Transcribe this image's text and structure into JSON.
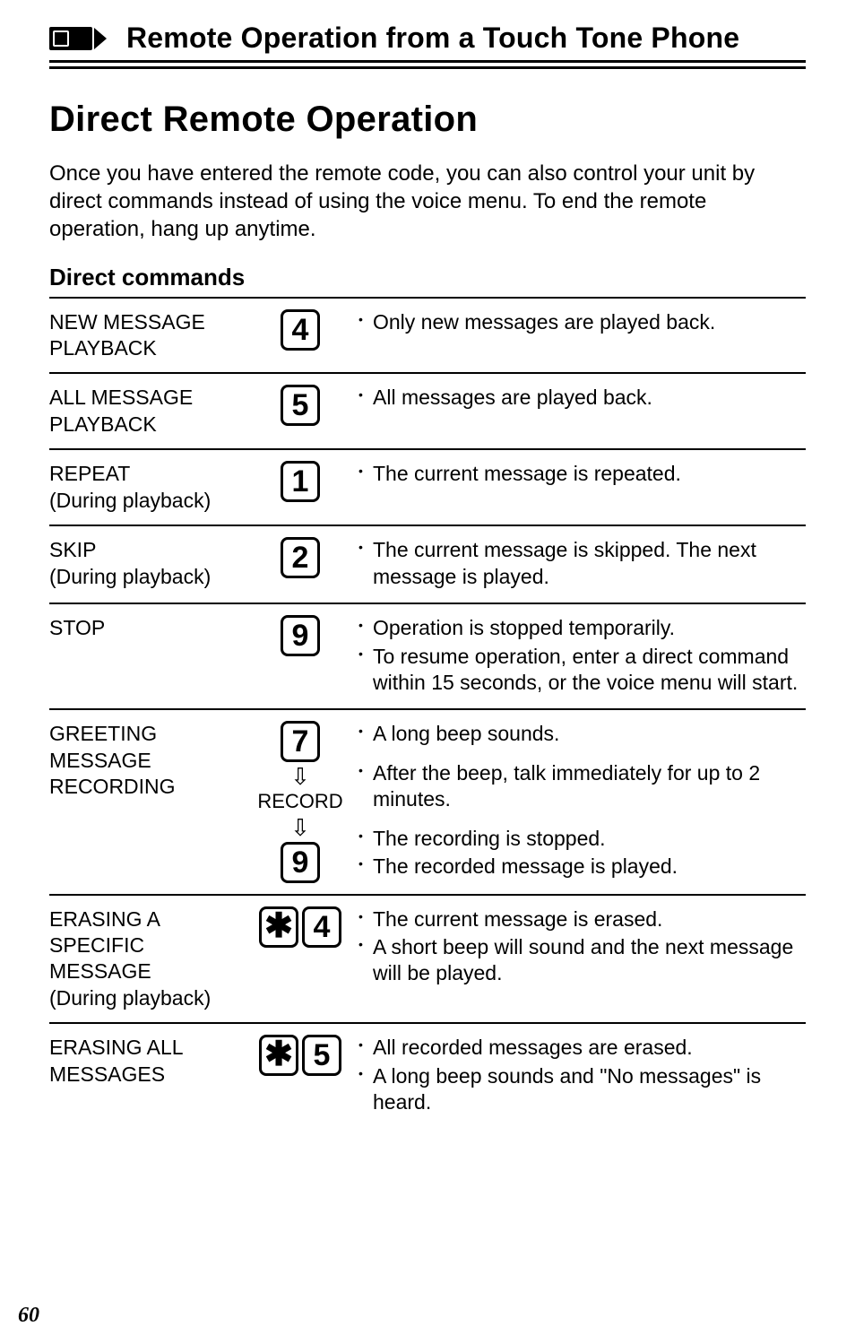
{
  "header": {
    "section_title": "Remote Operation from a Touch Tone Phone"
  },
  "title": "Direct Remote Operation",
  "intro": "Once you have entered the remote code, you can also control your unit by direct commands instead of using the voice menu. To end the remote operation, hang up anytime.",
  "subheading": "Direct commands",
  "page_number": "60",
  "record_label": "RECORD",
  "commands": [
    {
      "label": "NEW MESSAGE\nPLAYBACK",
      "keys": [
        "4"
      ],
      "desc": [
        "Only new messages are played back."
      ]
    },
    {
      "label": "ALL MESSAGE\nPLAYBACK",
      "keys": [
        "5"
      ],
      "desc": [
        "All messages are played back."
      ]
    },
    {
      "label": "REPEAT\n(During playback)",
      "keys": [
        "1"
      ],
      "desc": [
        "The current message is repeated."
      ]
    },
    {
      "label": "SKIP\n(During playback)",
      "keys": [
        "2"
      ],
      "desc": [
        "The current message is skipped. The next message is played."
      ]
    },
    {
      "label": "STOP",
      "keys": [
        "9"
      ],
      "desc": [
        "Operation is stopped temporarily.",
        "To resume operation, enter a direct command within 15 seconds, or the voice menu will start."
      ]
    },
    {
      "label": "GREETING\nMESSAGE\nRECORDING",
      "keys_sequence": [
        "7",
        "↓",
        "RECORD",
        "↓",
        "9"
      ],
      "desc_groups": [
        [
          "A long beep sounds."
        ],
        [
          "After the beep, talk immediately for up to 2 minutes."
        ],
        [
          "The recording is stopped.",
          "The recorded message is played."
        ]
      ]
    },
    {
      "label": "ERASING A\nSPECIFIC\nMESSAGE\n(During playback)",
      "keys": [
        "✱",
        "4"
      ],
      "desc": [
        "The current message is erased.",
        "A short beep will sound and the next message will be played."
      ]
    },
    {
      "label": "ERASING ALL\nMESSAGES",
      "keys": [
        "✱",
        "5"
      ],
      "desc": [
        "All recorded messages are erased.",
        "A long beep sounds and \"No messages\" is heard."
      ]
    }
  ]
}
